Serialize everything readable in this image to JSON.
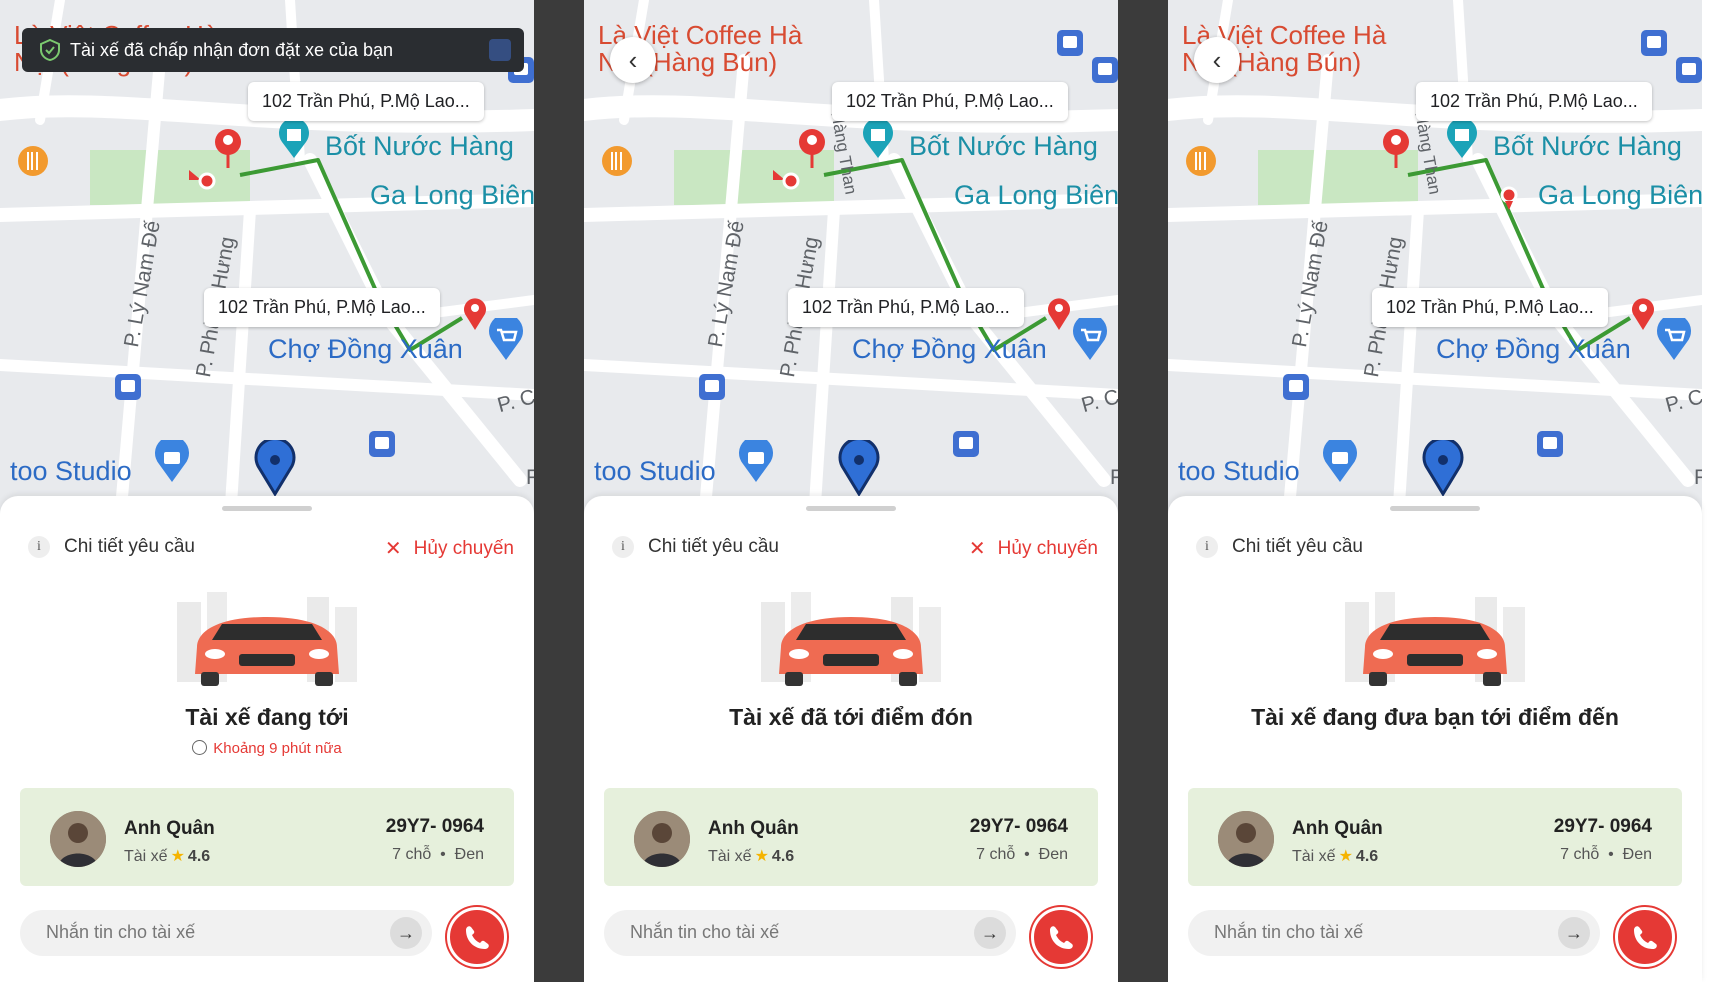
{
  "map": {
    "pois": {
      "coffee": "Là Việt Coffee Hà Nội (Hàng Bún)",
      "bot_nuoc": "Bốt Nước Hàng",
      "ga_long_bien": "Ga Long Biên",
      "cho_dong_xuan": "Chợ Đồng Xuân",
      "studio": "too Studio"
    },
    "streets": {
      "ly_nam_de": "P. Lý Nam Đế",
      "phung_hung": "P. Phùng Hưng",
      "p_ca": "P. Cả",
      "p_right": "P",
      "hang_than": "Hàng Than"
    },
    "pickup_address": "102 Trần Phú, P.Mộ Lao...",
    "destination_address": "102 Trần Phú, P.Mộ Lao..."
  },
  "toast": "Tài xế đã chấp nhận đơn đặt xe của bạn",
  "panels": [
    {
      "detail_label": "Chi tiết yêu cầu",
      "cancel_label": "Hủy chuyến",
      "status": "Tài xế đang tới",
      "eta": "Khoảng 9 phút nữa"
    },
    {
      "detail_label": "Chi tiết yêu cầu",
      "cancel_label": "Hủy chuyến",
      "status": "Tài xế đã tới điểm đón"
    },
    {
      "detail_label": "Chi tiết yêu cầu",
      "status": "Tài xế đang đưa bạn tới điểm đến"
    }
  ],
  "driver": {
    "name": "Anh Quân",
    "role": "Tài xế",
    "rating": "4.6",
    "plate": "29Y7- 0964",
    "seats": "7 chỗ",
    "separator": "•",
    "color": "Đen"
  },
  "message_placeholder": "Nhắn tin cho tài xế",
  "colors": {
    "accent_red": "#e53935",
    "route_green": "#3c9a34",
    "card_green": "#e6f0dc"
  }
}
